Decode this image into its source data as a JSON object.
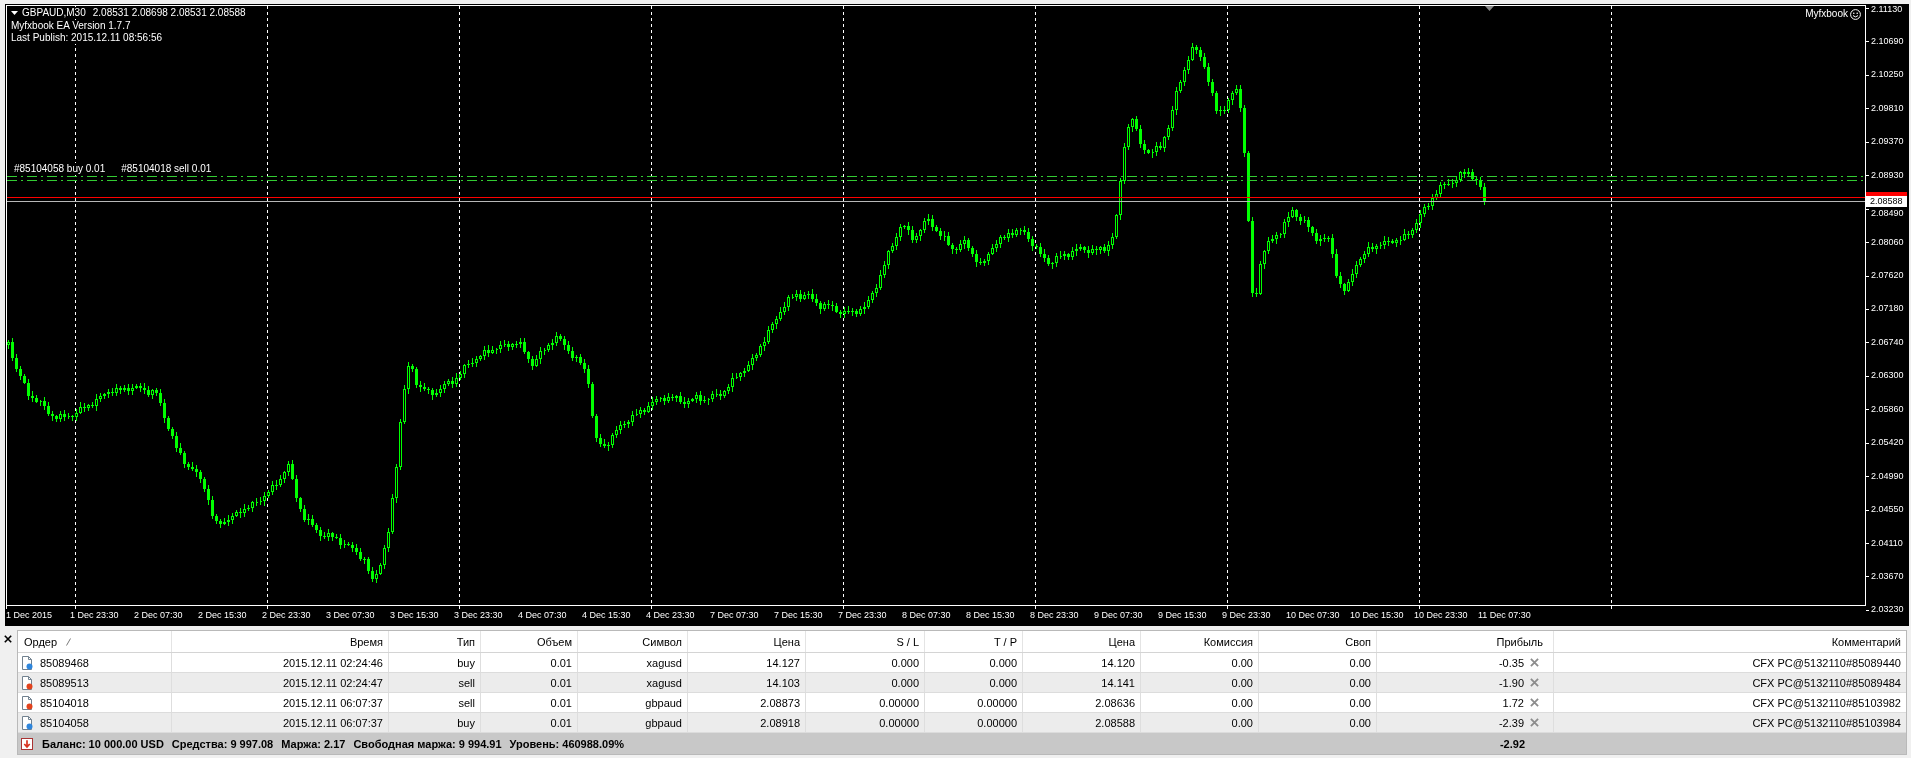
{
  "chart": {
    "symbol": "GBPAUD,M30",
    "quote": "2.08531 2.08698 2.08531 2.08588",
    "info_lines": [
      "Myfxbook EA Version 1.7.7",
      "Last Publish: 2015.12.11 08:56:56"
    ],
    "brand": "Myfxbook",
    "order_lines": [
      {
        "label": "#85104058 buy 0.01"
      },
      {
        "label": "#85104018 sell 0.01"
      }
    ],
    "price_axis": {
      "labels": [
        "2.11130",
        "2.10690",
        "2.10250",
        "2.09810",
        "2.09370",
        "2.08930",
        "2.08490",
        "2.08060",
        "2.07620",
        "2.07180",
        "2.06740",
        "2.06300",
        "2.05860",
        "2.05420",
        "2.04990",
        "2.04550",
        "2.04110",
        "2.03670",
        "2.03230"
      ],
      "current_price": "2.08588"
    },
    "time_axis": {
      "labels": [
        "1 Dec 2015",
        "1 Dec 23:30",
        "2 Dec 07:30",
        "2 Dec 15:30",
        "2 Dec 23:30",
        "3 Dec 07:30",
        "3 Dec 15:30",
        "3 Dec 23:30",
        "4 Dec 07:30",
        "4 Dec 15:30",
        "4 Dec 23:30",
        "7 Dec 07:30",
        "7 Dec 15:30",
        "7 Dec 23:30",
        "8 Dec 07:30",
        "8 Dec 15:30",
        "8 Dec 23:30",
        "9 Dec 07:30",
        "9 Dec 15:30",
        "9 Dec 23:30",
        "10 Dec 07:30",
        "10 Dec 15:30",
        "10 Dec 23:30",
        "11 Dec 07:30"
      ]
    }
  },
  "terminal": {
    "columns": [
      {
        "label": "Ордер",
        "sorted": true
      },
      {
        "label": "Время",
        "sorted": false
      },
      {
        "label": "Тип",
        "sorted": false
      },
      {
        "label": "Объем",
        "sorted": false
      },
      {
        "label": "Символ",
        "sorted": false
      },
      {
        "label": "Цена",
        "sorted": false
      },
      {
        "label": "S / L",
        "sorted": false
      },
      {
        "label": "T / P",
        "sorted": false
      },
      {
        "label": "Цена",
        "sorted": false
      },
      {
        "label": "Комиссия",
        "sorted": false
      },
      {
        "label": "Своп",
        "sorted": false
      },
      {
        "label": "Прибыль",
        "sorted": false
      },
      {
        "label": "Комментарий",
        "sorted": false
      }
    ],
    "rows": [
      {
        "kind": "buy",
        "cells": [
          "85089468",
          "2015.12.11 02:24:46",
          "buy",
          "0.01",
          "xagusd",
          "14.127",
          "0.000",
          "0.000",
          "14.120",
          "0.00",
          "0.00",
          "-0.35",
          "CFX PC@5132110#85089440"
        ]
      },
      {
        "kind": "sell",
        "cells": [
          "85089513",
          "2015.12.11 02:24:47",
          "sell",
          "0.01",
          "xagusd",
          "14.103",
          "0.000",
          "0.000",
          "14.141",
          "0.00",
          "0.00",
          "-1.90",
          "CFX PC@5132110#85089484"
        ]
      },
      {
        "kind": "sell",
        "cells": [
          "85104018",
          "2015.12.11 06:07:37",
          "sell",
          "0.01",
          "gbpaud",
          "2.08873",
          "0.00000",
          "0.00000",
          "2.08636",
          "0.00",
          "0.00",
          "1.72",
          "CFX PC@5132110#85103982"
        ]
      },
      {
        "kind": "buy",
        "cells": [
          "85104058",
          "2015.12.11 06:07:37",
          "buy",
          "0.01",
          "gbpaud",
          "2.08918",
          "0.00000",
          "0.00000",
          "2.08588",
          "0.00",
          "0.00",
          "-2.39",
          "CFX PC@5132110#85103984"
        ]
      }
    ],
    "summary": {
      "items": [
        "Баланс: 10 000.00 USD",
        "Средства: 9 997.08",
        "Маржа: 2.17",
        "Свободная маржа: 9 994.91",
        "Уровень: 460988.09%"
      ],
      "total": "-2.92"
    }
  }
}
